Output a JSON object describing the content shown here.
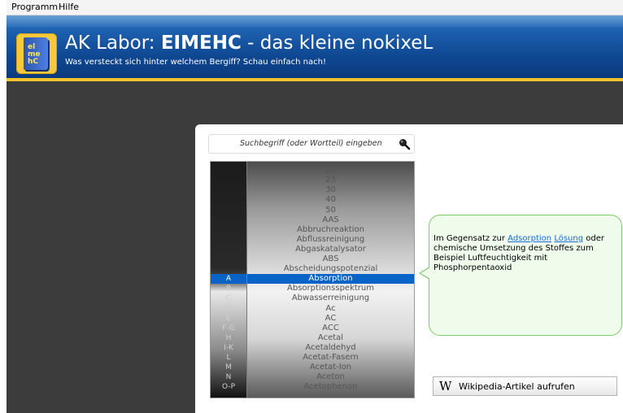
{
  "menu": [
    "Programm",
    "Hilfe"
  ],
  "header": {
    "title_prefix": "AK Labor:",
    "title_brand": "EIMEHC",
    "title_suffix": "- das kleine nokixeL",
    "subtitle": "Was versteckt sich hinter welchem Bergiff? Schau einfach nach!",
    "logo_text": "el\nme\nhC"
  },
  "search": {
    "placeholder": "Suchbegriff (oder Wortteil) eingeben",
    "icon": "magnifier-icon"
  },
  "letters": [
    "",
    "",
    "",
    "",
    "",
    "",
    "",
    "",
    "",
    "",
    "",
    "A",
    "B",
    "C",
    "D",
    "E",
    "F-G",
    "H",
    "I-K",
    "L",
    "M",
    "N",
    "O-P"
  ],
  "terms": [
    "",
    "22",
    "23",
    "30",
    "40",
    "50",
    "AAS",
    "Abbruchreaktion",
    "Abflussreinigung",
    "Abgaskatalysator",
    "ABS",
    "Abscheidungspotenzial",
    "Absorption",
    "Absorptionsspektrum",
    "Abwasserreinigung",
    "Ac",
    "AC",
    "ACC",
    "Acetal",
    "Acetaldehyd",
    "Acetat-Fasern",
    "Acetat-Ion",
    "Aceton",
    "Acetophenon"
  ],
  "selected_index": 11,
  "bubble": {
    "part1": "Im Gegensatz zur ",
    "link1": "Adsorption",
    "link2": "Lösung",
    "part2": " oder chemische Umsetzung des Stoffes zum Beispiel Luftfeuchtigkeit mit Phosphorpentaoxid"
  },
  "wiki_button": {
    "icon": "W",
    "label": "Wikipedia-Artikel aufrufen"
  },
  "colors": {
    "header_blue": "#0e4690",
    "accent_gold": "#f2c32b",
    "selection_blue": "#0a64c8",
    "bubble_green": "#effcec"
  }
}
